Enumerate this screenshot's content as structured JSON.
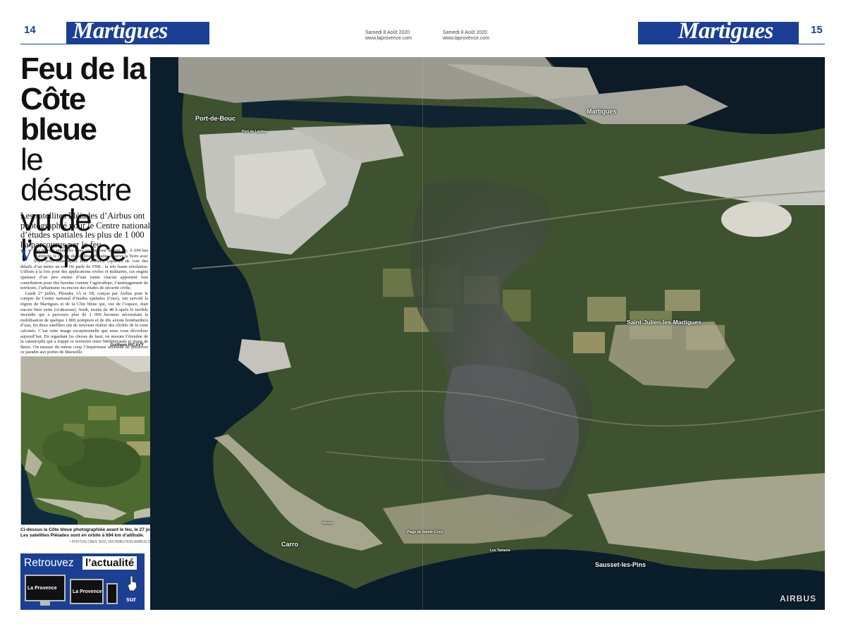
{
  "header": {
    "left_page_number": "14",
    "right_page_number": "15",
    "section_left": "Martigues",
    "section_right": "Martigues",
    "date_left": "Samedi 8 Août 2020",
    "site_left": "www.laprovence.com",
    "date_right": "Samedi 8 Août 2020",
    "site_right": "www.laprovence.com",
    "brand_color": "#1b3f94"
  },
  "article": {
    "title_line1": "Feu de la",
    "title_line2": "Côte bleue",
    "title_line3": "le désastre",
    "title_line4": "vu de",
    "title_line5": "l’espace",
    "lead": "Les satellites Pléiades d’Airbus ont photographié pour le Centre national d’études spatiales les plus de 1 000 ha parcourus par le feu",
    "dropcap": "V",
    "paragraph1": "ous pouvez remballer votre smartphone dernier cri. À 694 km d’altitude, le couple de satellites Pléiades observe la Terre avec leurs yeux numériques hors normes, capables de voir des détails d’un mètre au sol. On parle de THR : la très haute résolution. Utilisés à la fois pour des applications civiles et militaires, ces engins spatiaux d’un peu moins d’une tonne chacun apportent leur contribution pour des besoins comme l’agriculture, l’aménagement du territoire, l’urbanisme ou encore des études de sécurité civile.",
    "paragraph2": "Lundi 27 juillet, Pléiades 1A et 1B, conçus par Airbus pour le compte du Centre national d’études spatiales (Cnes), ont survolé la région de Martigues et de la Côte bleue qui, vue de l’espace, était encore bien verte (ci-dessous). Jeudi, moins de 48 h après le terrible incendie qui a parcouru plus de 1 000 hectares nécessitant la mobilisation de quelque 1 800 pompiers et de dix avions bombardiers d’eau, les deux satellites ont de nouveau réalisé des clichés de la zone calcinée. C’est cette image exceptionnelle que nous vous dévoilons aujourd’hui. En regardant les choses de haut, on mesure l’étendue de la catastrophe qui a frappé ce territoire entre Méditerranée et étang de Berre. On mesure du même coup l’impérieuse nécessité de préserver ce paradis aux portes de Marseille.",
    "byline": "Guilhem RICAVY"
  },
  "inset": {
    "caption_line1": "Ci-dessus la Côte bleue photographiée avant le feu, le 27 juillet.",
    "caption_line2": "Les satellites Pléiades sont en orbite à 694 km d’altitude.",
    "credit": "/ PHOTOS CNES 2020, DISTRIBUTION AIRBUS DS"
  },
  "promo": {
    "text_retrouvez": "Retrouvez",
    "text_actualite": "l’actualité",
    "text_sur": "sur",
    "device_label": "La Provence"
  },
  "map": {
    "labels": {
      "port_de_bouc": "Port-de-Bouc",
      "port_de_lavera": "Port de Lavéra",
      "martigues": "Martigues",
      "saint_julien": "Saint-Julien-les-Martigues",
      "carro": "Carro",
      "plage_sainte_croix": "Plage de Sainte-Croix",
      "les_tamaris": "Les Tamaris",
      "sausset": "Sausset-les-Pins",
      "verdon": "Verdon"
    },
    "watermark": "AIRBUS"
  }
}
